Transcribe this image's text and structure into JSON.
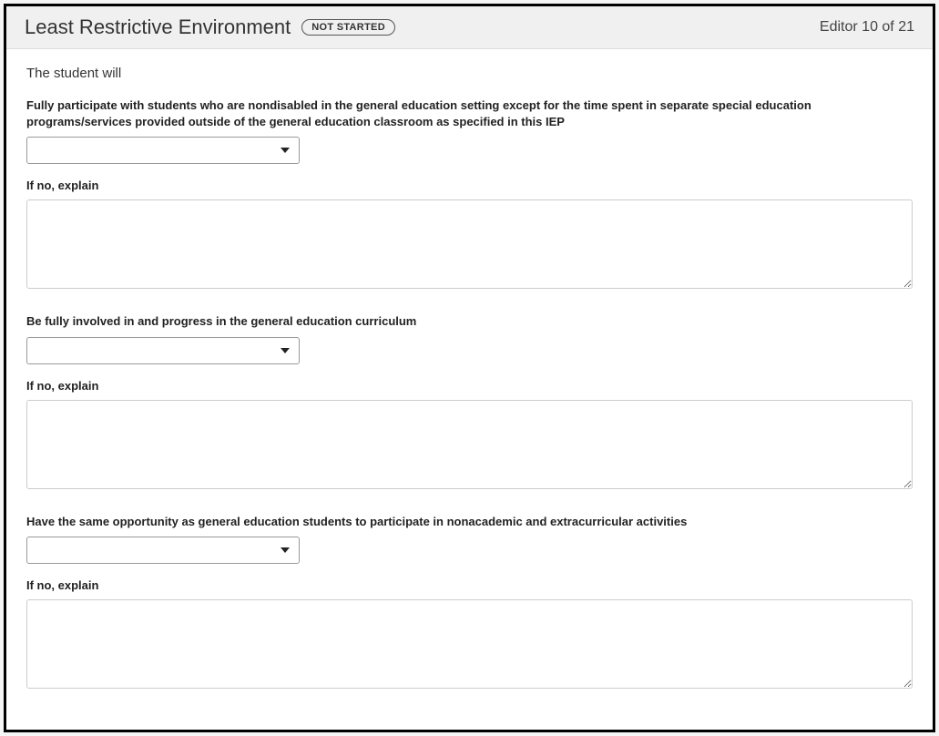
{
  "header": {
    "title": "Least Restrictive Environment",
    "status": "NOT STARTED",
    "editor_count": "Editor 10 of 21"
  },
  "intro": "The student will",
  "questions": [
    {
      "label": "Fully participate with students who are nondisabled in the general education setting except for the time spent in separate special education programs/services provided outside of the general education classroom as specified in this IEP",
      "select_value": "",
      "explain_label": "If no, explain",
      "explain_value": ""
    },
    {
      "label": "Be fully involved in and progress in the general education curriculum",
      "select_value": "",
      "explain_label": "If no, explain",
      "explain_value": ""
    },
    {
      "label": "Have the same opportunity as general education students to participate in nonacademic and extracurricular activities",
      "select_value": "",
      "explain_label": "If no, explain",
      "explain_value": ""
    }
  ]
}
